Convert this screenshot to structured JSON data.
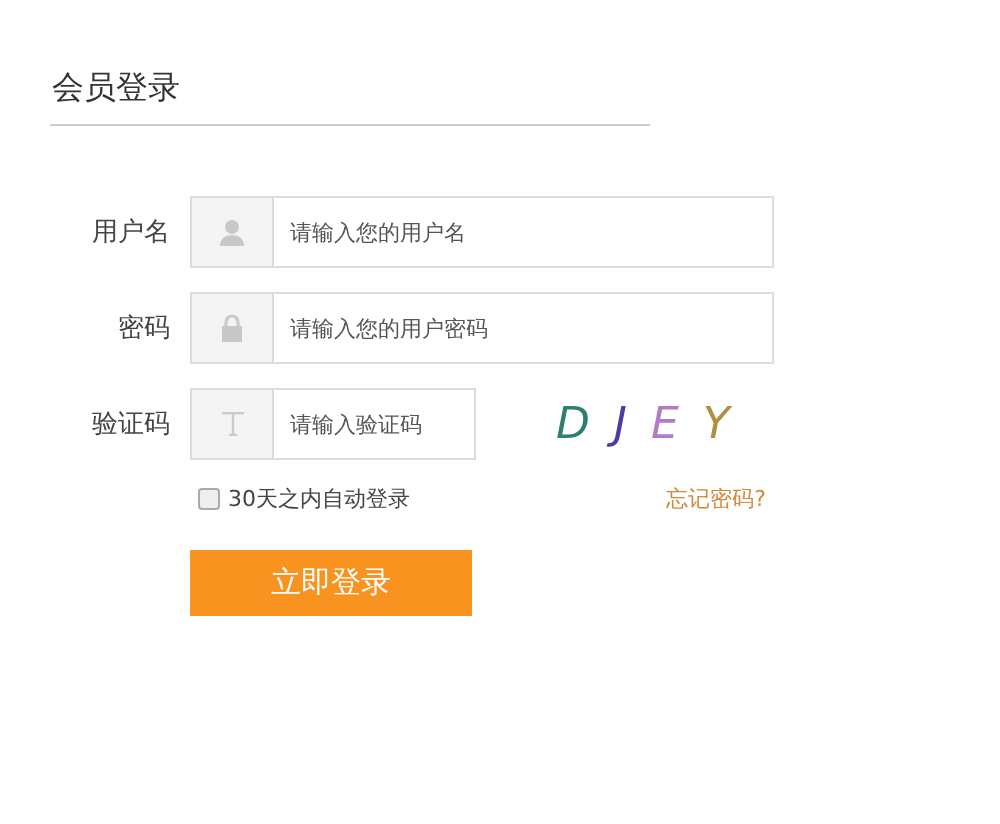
{
  "title": "会员登录",
  "fields": [
    {
      "label": "用户名",
      "kind": "username",
      "placeholder": "请输入您的用户名"
    },
    {
      "label": "密码",
      "kind": "password",
      "placeholder": "请输入您的用户密码"
    },
    {
      "label": "验证码",
      "kind": "captcha",
      "placeholder": "请输入验证码"
    }
  ],
  "captcha": [
    {
      "char": "D",
      "color": "#2f7f6f"
    },
    {
      "char": "J",
      "color": "#4a3fa0"
    },
    {
      "char": "E",
      "color": "#b07cc8"
    },
    {
      "char": "Y",
      "color": "#b09040"
    }
  ],
  "remember": {
    "label": "30天之内自动登录",
    "checked": false
  },
  "forgot_link": "忘记密码?",
  "submit_button": "立即登录"
}
